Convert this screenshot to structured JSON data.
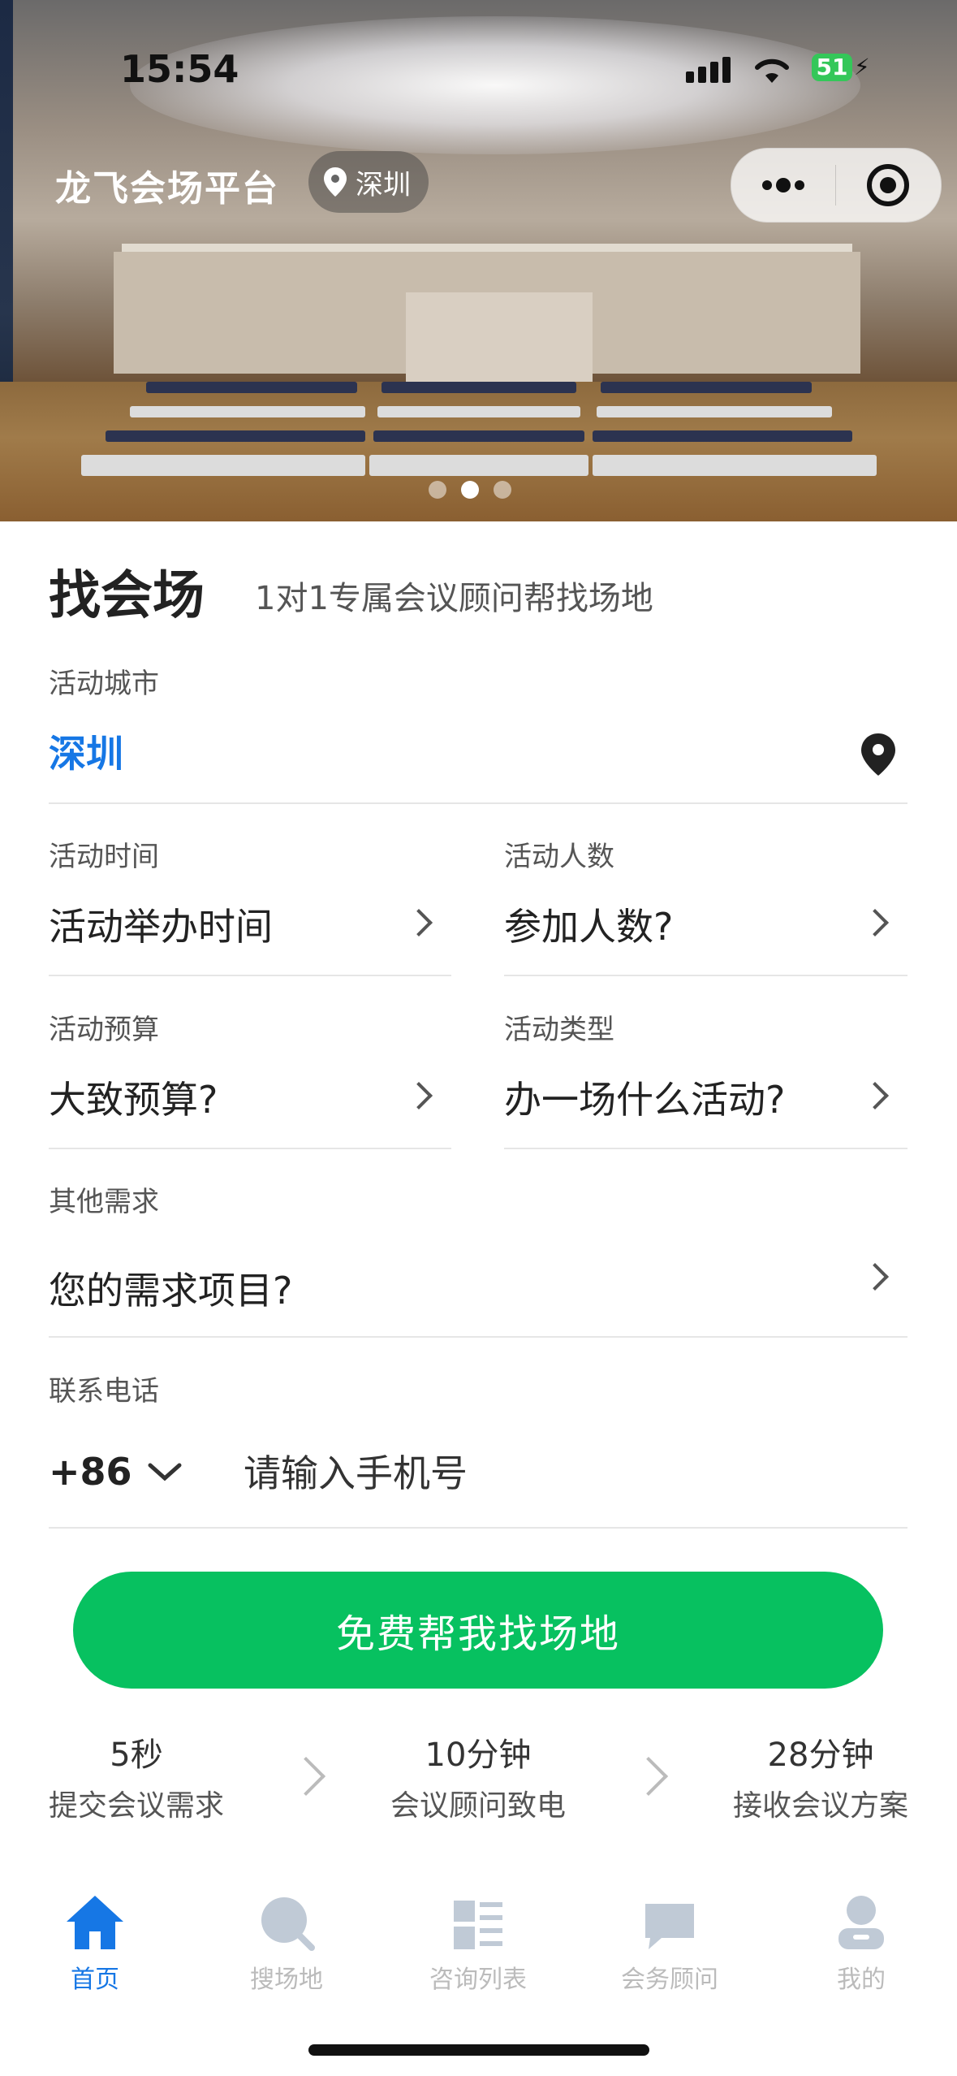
{
  "status_bar": {
    "time": "15:54",
    "battery": "51"
  },
  "nav": {
    "app_title": "龙飞会场平台",
    "city": "深圳"
  },
  "form": {
    "title": "找会场",
    "subtitle": "1对1专属会议顾问帮找场地",
    "city_label": "活动城市",
    "city_value": "深圳",
    "time_label": "活动时间",
    "time_value": "活动举办时间",
    "people_label": "活动人数",
    "people_value": "参加人数?",
    "budget_label": "活动预算",
    "budget_value": "大致预算?",
    "type_label": "活动类型",
    "type_value": "办一场什么活动?",
    "other_label": "其他需求",
    "other_value": "您的需求项目?",
    "phone_label": "联系电话",
    "country_code": "+86",
    "phone_placeholder": "请输入手机号"
  },
  "cta": {
    "label": "免费帮我找场地"
  },
  "steps": [
    {
      "time": "5秒",
      "text": "提交会议需求"
    },
    {
      "time": "10分钟",
      "text": "会议顾问致电"
    },
    {
      "time": "28分钟",
      "text": "接收会议方案"
    }
  ],
  "tabs": [
    {
      "label": "首页",
      "icon": "home-icon"
    },
    {
      "label": "搜场地",
      "icon": "search-icon"
    },
    {
      "label": "咨询列表",
      "icon": "list-icon"
    },
    {
      "label": "会务顾问",
      "icon": "chat-icon"
    },
    {
      "label": "我的",
      "icon": "user-icon"
    }
  ],
  "colors": {
    "accent": "#1677e5",
    "cta": "#07c160",
    "tab_inactive": "#bbbbbb"
  }
}
